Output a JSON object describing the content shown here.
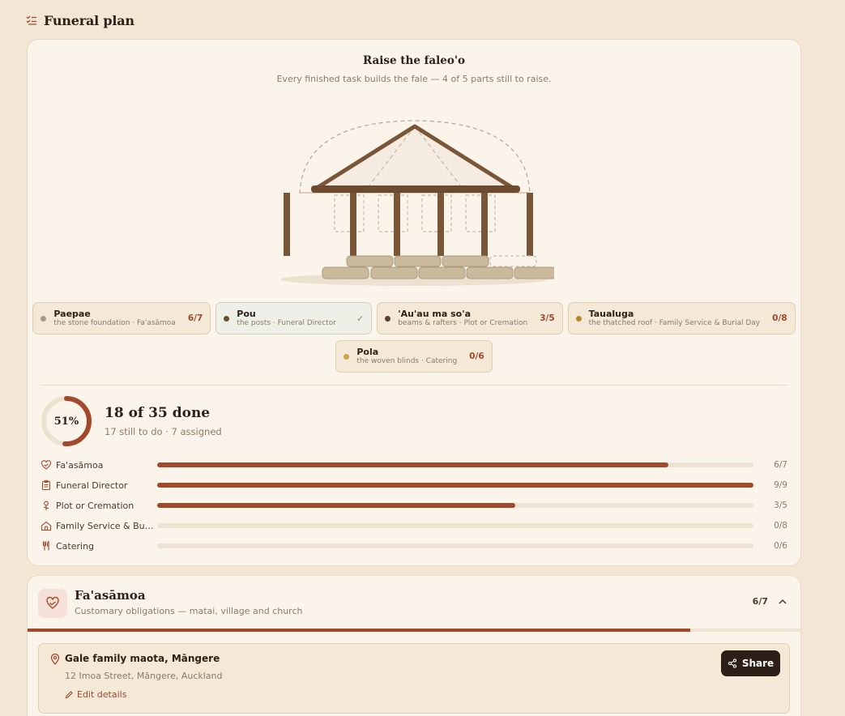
{
  "header": {
    "title": "Funeral plan",
    "icon": "checklist-icon"
  },
  "fale": {
    "title": "Raise the faleo'o",
    "subtitle": "Every finished task builds the fale — 4 of 5 parts still to raise.",
    "parts_row1": [
      {
        "name": "Paepae",
        "desc": "the stone foundation · Fa'asāmoa",
        "count": "6/7",
        "dot": "#a89a82",
        "done": false
      },
      {
        "name": "Pou",
        "desc": "the posts · Funeral Director",
        "count": "",
        "dot": "#6b4e36",
        "done": true
      },
      {
        "name": "'Au'au ma so'a",
        "desc": "beams & rafters · Plot or Cremation",
        "count": "3/5",
        "dot": "#5a4030",
        "done": false
      },
      {
        "name": "Taualuga",
        "desc": "the thatched roof · Family Service & Burial Day",
        "count": "0/8",
        "dot": "#b8872e",
        "done": false
      }
    ],
    "parts_row2": [
      {
        "name": "Pola",
        "desc": "the woven blinds · Catering",
        "count": "0/6",
        "dot": "#c9a24a",
        "done": false
      }
    ]
  },
  "summary": {
    "percent_label": "51%",
    "percent": 0.51,
    "title": "18 of 35 done",
    "subtitle": "17 still to do · 7 assigned"
  },
  "progress": [
    {
      "label": "Fa'asāmoa",
      "icon": "heart-hand-icon",
      "count": "6/7",
      "fraction": 0.857
    },
    {
      "label": "Funeral Director",
      "icon": "clipboard-icon",
      "count": "9/9",
      "fraction": 1.0
    },
    {
      "label": "Plot or Cremation",
      "icon": "flower-icon",
      "count": "3/5",
      "fraction": 0.6
    },
    {
      "label": "Family Service & Burial Day",
      "icon": "chapel-icon",
      "count": "0/8",
      "fraction": 0
    },
    {
      "label": "Catering",
      "icon": "utensils-icon",
      "count": "0/6",
      "fraction": 0
    }
  ],
  "section": {
    "title": "Fa'asāmoa",
    "subtitle": "Customary obligations — matai, village and church",
    "count": "6/7",
    "fraction": 0.857,
    "location": {
      "name": "Gale family maota, Māngere",
      "address": "12 Imoa Street, Māngere, Auckland",
      "edit_label": "Edit details",
      "share_label": "Share"
    }
  },
  "colors": {
    "accent": "#a3492b",
    "ink": "#2d2119",
    "muted": "#8c7a68",
    "wood": "#7a5638"
  }
}
